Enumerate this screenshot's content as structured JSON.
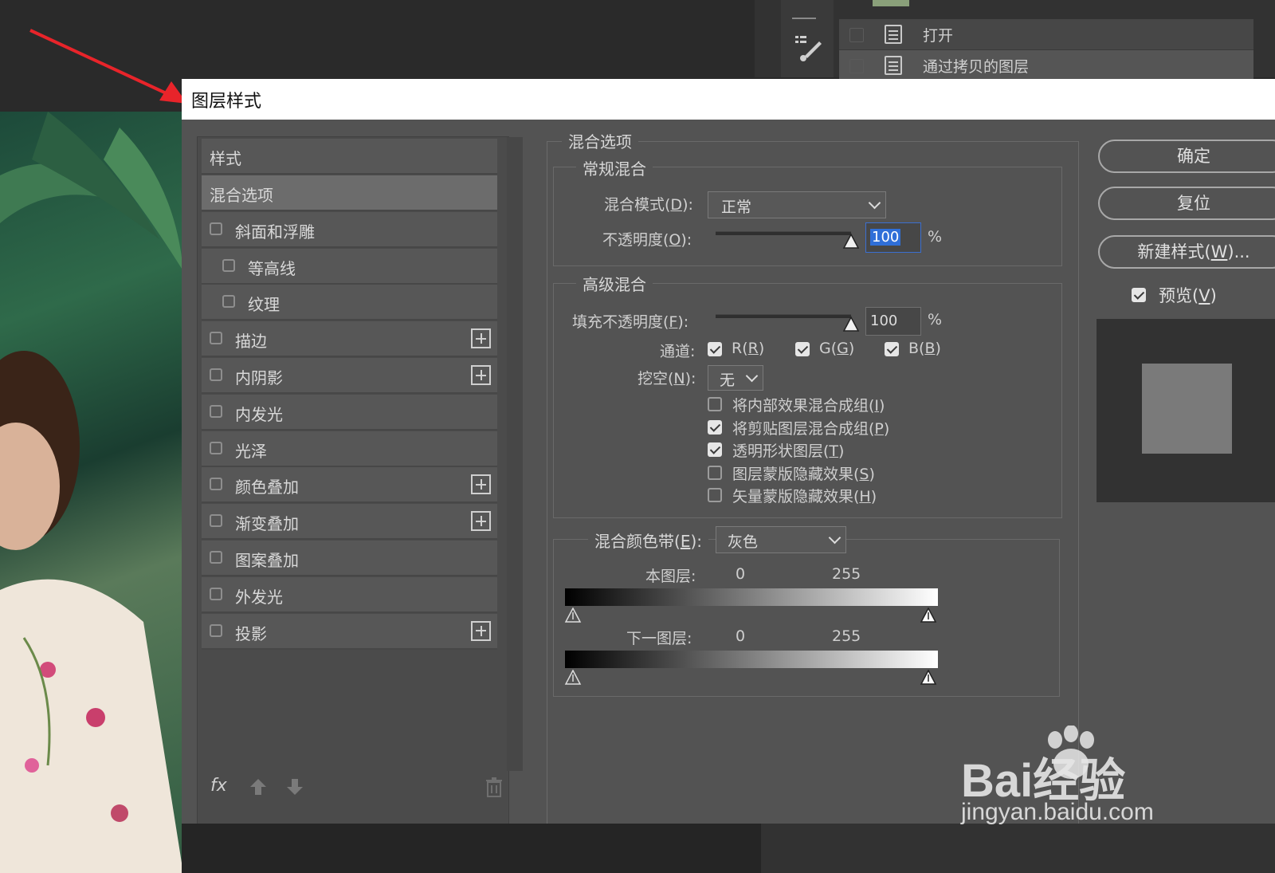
{
  "history_panel": {
    "items": [
      {
        "label": "打开"
      },
      {
        "label": "通过拷贝的图层"
      }
    ]
  },
  "dialog": {
    "title": "图层样式",
    "styles_header": "样式",
    "styles": [
      {
        "label": "混合选项",
        "checkbox": false,
        "selected": true,
        "indent": false,
        "plus": false
      },
      {
        "label": "斜面和浮雕",
        "checkbox": true,
        "checked": false,
        "indent": false,
        "plus": false
      },
      {
        "label": "等高线",
        "checkbox": true,
        "checked": false,
        "indent": true,
        "plus": false
      },
      {
        "label": "纹理",
        "checkbox": true,
        "checked": false,
        "indent": true,
        "plus": false
      },
      {
        "label": "描边",
        "checkbox": true,
        "checked": false,
        "indent": false,
        "plus": true
      },
      {
        "label": "内阴影",
        "checkbox": true,
        "checked": false,
        "indent": false,
        "plus": true
      },
      {
        "label": "内发光",
        "checkbox": true,
        "checked": false,
        "indent": false,
        "plus": false
      },
      {
        "label": "光泽",
        "checkbox": true,
        "checked": false,
        "indent": false,
        "plus": false
      },
      {
        "label": "颜色叠加",
        "checkbox": true,
        "checked": false,
        "indent": false,
        "plus": true
      },
      {
        "label": "渐变叠加",
        "checkbox": true,
        "checked": false,
        "indent": false,
        "plus": true
      },
      {
        "label": "图案叠加",
        "checkbox": true,
        "checked": false,
        "indent": false,
        "plus": false
      },
      {
        "label": "外发光",
        "checkbox": true,
        "checked": false,
        "indent": false,
        "plus": false
      },
      {
        "label": "投影",
        "checkbox": true,
        "checked": false,
        "indent": false,
        "plus": true
      }
    ],
    "footer": {
      "fx": "fx"
    },
    "blend_options": {
      "title": "混合选项",
      "general": {
        "title": "常规混合",
        "blend_mode_label": "混合模式(",
        "blend_mode_key": "D",
        "blend_mode_suffix": "):",
        "blend_mode_value": "正常",
        "opacity_label": "不透明度(",
        "opacity_key": "O",
        "opacity_suffix": "):",
        "opacity_value": "100",
        "opacity_level": 1.0,
        "percent": "%"
      },
      "advanced": {
        "title": "高级混合",
        "fill_label": "填充不透明度(",
        "fill_key": "F",
        "fill_suffix": "):",
        "fill_value": "100",
        "fill_level": 1.0,
        "percent": "%",
        "channels_label": "通道:",
        "channels": [
          {
            "label": "R(",
            "key": "R",
            "suffix": ")",
            "checked": true
          },
          {
            "label": "G(",
            "key": "G",
            "suffix": ")",
            "checked": true
          },
          {
            "label": "B(",
            "key": "B",
            "suffix": ")",
            "checked": true
          }
        ],
        "knockout_label": "挖空(",
        "knockout_key": "N",
        "knockout_suffix": "):",
        "knockout_value": "无",
        "options": [
          {
            "label": "将内部效果混合成组(",
            "key": "I",
            "suffix": ")",
            "checked": false
          },
          {
            "label": "将剪贴图层混合成组(",
            "key": "P",
            "suffix": ")",
            "checked": true
          },
          {
            "label": "透明形状图层(",
            "key": "T",
            "suffix": ")",
            "checked": true
          },
          {
            "label": "图层蒙版隐藏效果(",
            "key": "S",
            "suffix": ")",
            "checked": false
          },
          {
            "label": "矢量蒙版隐藏效果(",
            "key": "H",
            "suffix": ")",
            "checked": false
          }
        ]
      },
      "blend_if": {
        "label": "混合颜色带(",
        "key": "E",
        "suffix": "):",
        "value": "灰色",
        "this_layer_label": "本图层:",
        "this_layer_min": "0",
        "this_layer_max": "255",
        "underlying_label": "下一图层:",
        "underlying_min": "0",
        "underlying_max": "255"
      }
    },
    "buttons": {
      "ok": "确定",
      "reset": "复位",
      "new_style_prefix": "新建样式(",
      "new_style_key": "W",
      "new_style_suffix": ")...",
      "preview_prefix": "预览(",
      "preview_key": "V",
      "preview_suffix": ")",
      "preview_checked": true
    }
  },
  "watermark": {
    "brand": "Bai经验",
    "url": "jingyan.baidu.com"
  }
}
